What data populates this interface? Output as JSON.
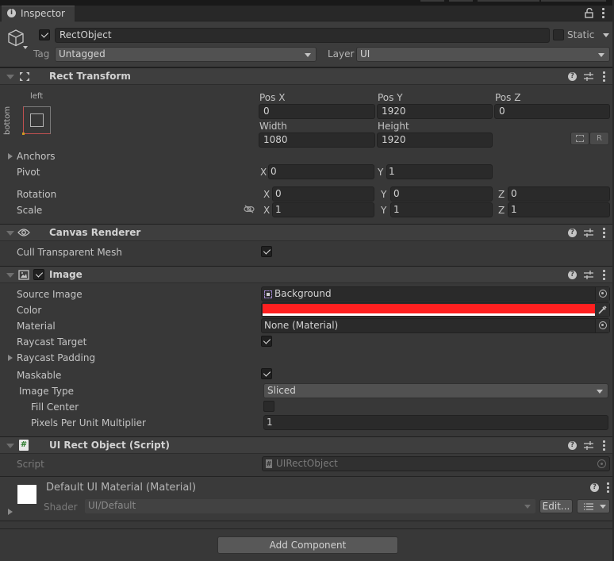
{
  "window": {
    "tab_title": "Inspector"
  },
  "object": {
    "active": true,
    "name": "RectObject",
    "static_label": "Static",
    "static_checked": false,
    "tag_label": "Tag",
    "tag_value": "Untagged",
    "layer_label": "Layer",
    "layer_value": "UI"
  },
  "rect_transform": {
    "title": "Rect Transform",
    "anchor_preset_h": "left",
    "anchor_preset_v": "bottom",
    "pos_x_label": "Pos X",
    "pos_x": "0",
    "pos_y_label": "Pos Y",
    "pos_y": "1920",
    "pos_z_label": "Pos Z",
    "pos_z": "0",
    "width_label": "Width",
    "width": "1080",
    "height_label": "Height",
    "height": "1920",
    "raw_button": "R",
    "anchors_label": "Anchors",
    "pivot_label": "Pivot",
    "pivot_x": "0",
    "pivot_y": "1",
    "rotation_label": "Rotation",
    "rot_x": "0",
    "rot_y": "0",
    "rot_z": "0",
    "scale_label": "Scale",
    "scale_x": "1",
    "scale_y": "1",
    "scale_z": "1",
    "axis": {
      "x": "X",
      "y": "Y",
      "z": "Z"
    }
  },
  "canvas_renderer": {
    "title": "Canvas Renderer",
    "cull_label": "Cull Transparent Mesh",
    "cull_checked": true
  },
  "image": {
    "title": "Image",
    "enabled": true,
    "source_image_label": "Source Image",
    "source_image": "Background",
    "color_label": "Color",
    "color": "#ff2020",
    "material_label": "Material",
    "material": "None (Material)",
    "raycast_target_label": "Raycast Target",
    "raycast_target": true,
    "raycast_padding_label": "Raycast Padding",
    "maskable_label": "Maskable",
    "maskable": true,
    "image_type_label": "Image Type",
    "image_type": "Sliced",
    "fill_center_label": "Fill Center",
    "fill_center": false,
    "ppu_label": "Pixels Per Unit Multiplier",
    "ppu": "1"
  },
  "script_component": {
    "title": "UI Rect Object (Script)",
    "script_label": "Script",
    "script_value": "UIRectObject"
  },
  "material_preview": {
    "title": "Default UI Material (Material)",
    "shader_label": "Shader",
    "shader_value": "UI/Default",
    "edit_button": "Edit..."
  },
  "footer": {
    "add_component": "Add Component"
  }
}
